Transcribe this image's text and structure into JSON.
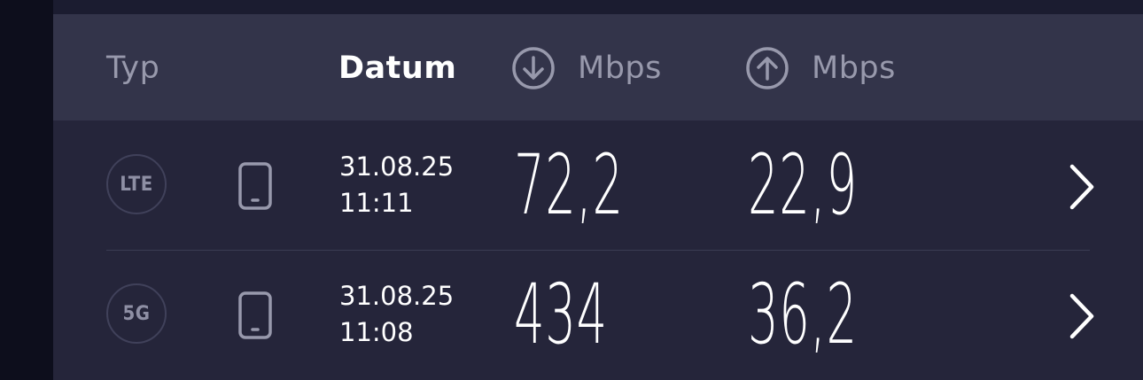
{
  "header": {
    "type_label": "Typ",
    "date_label": "Datum",
    "download_unit": "Mbps",
    "upload_unit": "Mbps",
    "download_icon": "arrow-down-circle-icon",
    "upload_icon": "arrow-up-circle-icon"
  },
  "results": [
    {
      "network": "LTE",
      "device_icon": "smartphone-icon",
      "date": "31.08.25",
      "time": "11:11",
      "download": "72,2",
      "upload": "22,9"
    },
    {
      "network": "5G",
      "device_icon": "smartphone-icon",
      "date": "31.08.25",
      "time": "11:08",
      "download": "434",
      "upload": "36,2"
    }
  ],
  "colors": {
    "background": "#0d0e1c",
    "panel": "#25253a",
    "header": "#33344a",
    "muted_text": "#9899ac",
    "primary_text": "#ffffff"
  }
}
